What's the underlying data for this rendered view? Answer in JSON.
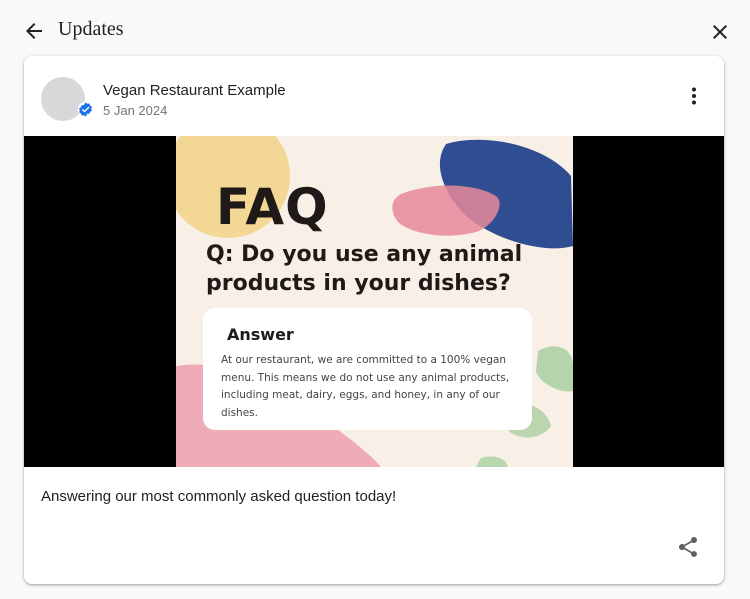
{
  "header": {
    "back_icon": "arrow-left-icon",
    "title": "Updates",
    "close_icon": "close-icon"
  },
  "post": {
    "author": "Vegan Restaurant Example",
    "date": "5 Jan 2024",
    "verified_icon": "verified-badge-icon",
    "more_icon": "more-vert-icon",
    "image": {
      "title": "FAQ",
      "question": "Q: Do you use any animal products in your dishes?",
      "answer_heading": "Answer",
      "answer_text": "At our restaurant, we are committed to a 100% vegan menu. This means we do not use any animal products, including meat, dairy, eggs, and honey, in any of our dishes."
    },
    "text": "Answering our most commonly asked question today!",
    "share_icon": "share-icon"
  },
  "colors": {
    "page_bg": "#f9f9f9",
    "card_bg": "#ffffff",
    "accent_blue": "#1a73e8",
    "muted_text": "#70757a"
  }
}
